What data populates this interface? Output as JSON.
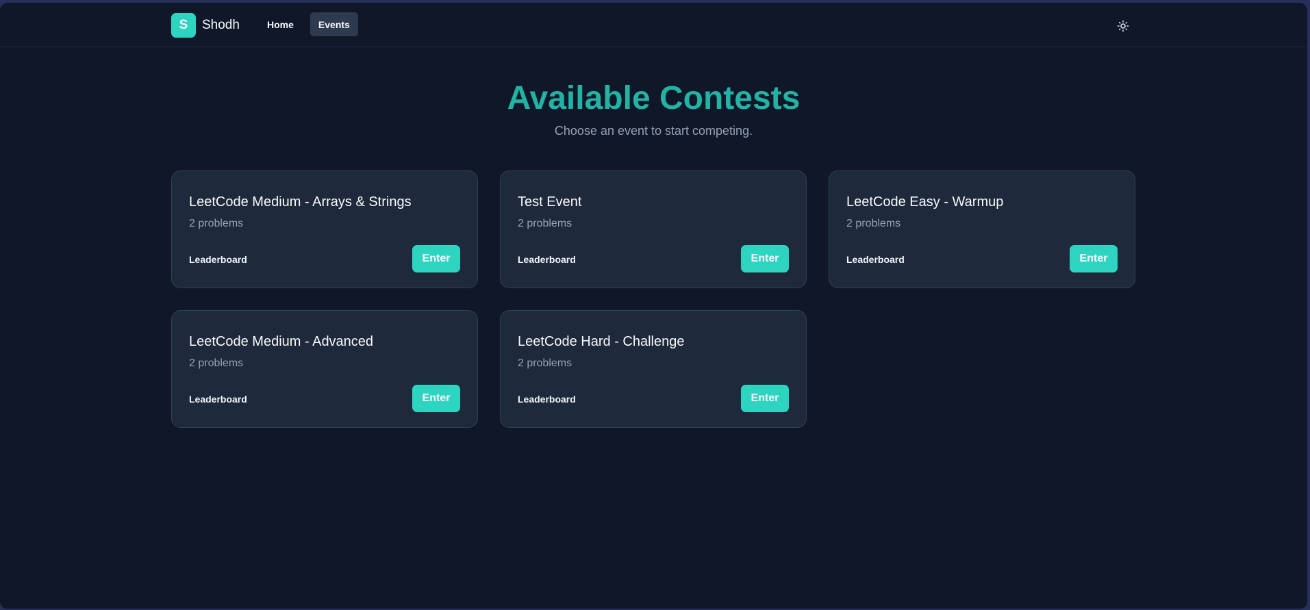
{
  "nav": {
    "logo_letter": "S",
    "brand": "Shodh",
    "links": [
      {
        "label": "Home",
        "active": false
      },
      {
        "label": "Events",
        "active": true
      }
    ],
    "theme_toggle_icon": "sun-icon"
  },
  "hero": {
    "title": "Available Contests",
    "subtitle": "Choose an event to start competing."
  },
  "contests": [
    {
      "title": "LeetCode Medium - Arrays & Strings",
      "problems": "2 problems",
      "leaderboard": "Leaderboard",
      "enter": "Enter"
    },
    {
      "title": "Test Event",
      "problems": "2 problems",
      "leaderboard": "Leaderboard",
      "enter": "Enter"
    },
    {
      "title": "LeetCode Easy - Warmup",
      "problems": "2 problems",
      "leaderboard": "Leaderboard",
      "enter": "Enter"
    },
    {
      "title": "LeetCode Medium - Advanced",
      "problems": "2 problems",
      "leaderboard": "Leaderboard",
      "enter": "Enter"
    },
    {
      "title": "LeetCode Hard - Challenge",
      "problems": "2 problems",
      "leaderboard": "Leaderboard",
      "enter": "Enter"
    }
  ],
  "colors": {
    "background": "#0f1729",
    "card": "#1e293b",
    "accent": "#2dd4bf",
    "title_accent": "#22b3a4",
    "muted_text": "#94a3b8"
  }
}
